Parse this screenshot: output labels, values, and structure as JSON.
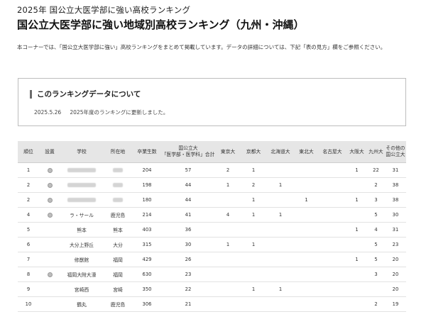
{
  "header": {
    "subtitle": "2025年 国公立大医学部に強い高校ランキング",
    "title": "国公立大医学部に強い地域別高校ランキング（九州・沖縄）",
    "intro": "本コーナーでは、「国公立大医学部に強い」高校ランキングをまとめて掲載しています。データの詳細については、下記「表の見方」欄をご参照ください。"
  },
  "info": {
    "title": "このランキングデータについて",
    "date": "2025.5.26",
    "message": "2025年度のランキングに更新しました。"
  },
  "table": {
    "headers": {
      "rank": "順位",
      "setup": "設置",
      "school": "学校",
      "location": "所在地",
      "graduates": "卒業生数",
      "total_line1": "国公立大",
      "total_line2": "「医学部・医学科」合計",
      "tokyo": "東京大",
      "kyoto": "京都大",
      "hokkaido": "北海道大",
      "tohoku": "東北大",
      "nagoya": "名古屋大",
      "osaka": "大阪大",
      "kyushu": "九州大",
      "other_line1": "その他の",
      "other_line2": "国公立大"
    },
    "rows": [
      {
        "rank": "1",
        "badge": true,
        "school": "",
        "location": "",
        "graduates": "204",
        "total": "57",
        "tokyo": "2",
        "kyoto": "1",
        "hokkaido": "",
        "tohoku": "",
        "nagoya": "",
        "osaka": "1",
        "kyushu": "22",
        "other": "31"
      },
      {
        "rank": "2",
        "badge": true,
        "school": "",
        "location": "",
        "graduates": "198",
        "total": "44",
        "tokyo": "1",
        "kyoto": "2",
        "hokkaido": "1",
        "tohoku": "",
        "nagoya": "",
        "osaka": "",
        "kyushu": "2",
        "other": "38"
      },
      {
        "rank": "2",
        "badge": true,
        "school": "",
        "location": "",
        "graduates": "180",
        "total": "44",
        "tokyo": "",
        "kyoto": "1",
        "hokkaido": "",
        "tohoku": "1",
        "nagoya": "",
        "osaka": "1",
        "kyushu": "3",
        "other": "38"
      },
      {
        "rank": "4",
        "badge": true,
        "school": "ラ・サール",
        "location": "鹿児島",
        "graduates": "214",
        "total": "41",
        "tokyo": "4",
        "kyoto": "1",
        "hokkaido": "1",
        "tohoku": "",
        "nagoya": "",
        "osaka": "",
        "kyushu": "5",
        "other": "30"
      },
      {
        "rank": "5",
        "badge": false,
        "school": "熊本",
        "location": "熊本",
        "graduates": "403",
        "total": "36",
        "tokyo": "",
        "kyoto": "",
        "hokkaido": "",
        "tohoku": "",
        "nagoya": "",
        "osaka": "1",
        "kyushu": "4",
        "other": "31"
      },
      {
        "rank": "6",
        "badge": false,
        "school": "大分上野丘",
        "location": "大分",
        "graduates": "315",
        "total": "30",
        "tokyo": "1",
        "kyoto": "1",
        "hokkaido": "",
        "tohoku": "",
        "nagoya": "",
        "osaka": "",
        "kyushu": "5",
        "other": "23"
      },
      {
        "rank": "7",
        "badge": false,
        "school": "修猷館",
        "location": "福岡",
        "graduates": "429",
        "total": "26",
        "tokyo": "",
        "kyoto": "",
        "hokkaido": "",
        "tohoku": "",
        "nagoya": "",
        "osaka": "1",
        "kyushu": "5",
        "other": "20"
      },
      {
        "rank": "8",
        "badge": true,
        "school": "福岡大附大濠",
        "location": "福岡",
        "graduates": "630",
        "total": "23",
        "tokyo": "",
        "kyoto": "",
        "hokkaido": "",
        "tohoku": "",
        "nagoya": "",
        "osaka": "",
        "kyushu": "3",
        "other": "20"
      },
      {
        "rank": "9",
        "badge": false,
        "school": "宮崎西",
        "location": "宮崎",
        "graduates": "350",
        "total": "22",
        "tokyo": "",
        "kyoto": "1",
        "hokkaido": "1",
        "tohoku": "",
        "nagoya": "",
        "osaka": "",
        "kyushu": "",
        "other": "20"
      },
      {
        "rank": "10",
        "badge": false,
        "school": "鶴丸",
        "location": "鹿児島",
        "graduates": "306",
        "total": "21",
        "tokyo": "",
        "kyoto": "",
        "hokkaido": "",
        "tohoku": "",
        "nagoya": "",
        "osaka": "",
        "kyushu": "2",
        "other": "19"
      }
    ]
  },
  "colors": {
    "header_bg": "#e6e6e6",
    "accent_bar": "#6b6b6b",
    "border": "#bdbdbd"
  }
}
